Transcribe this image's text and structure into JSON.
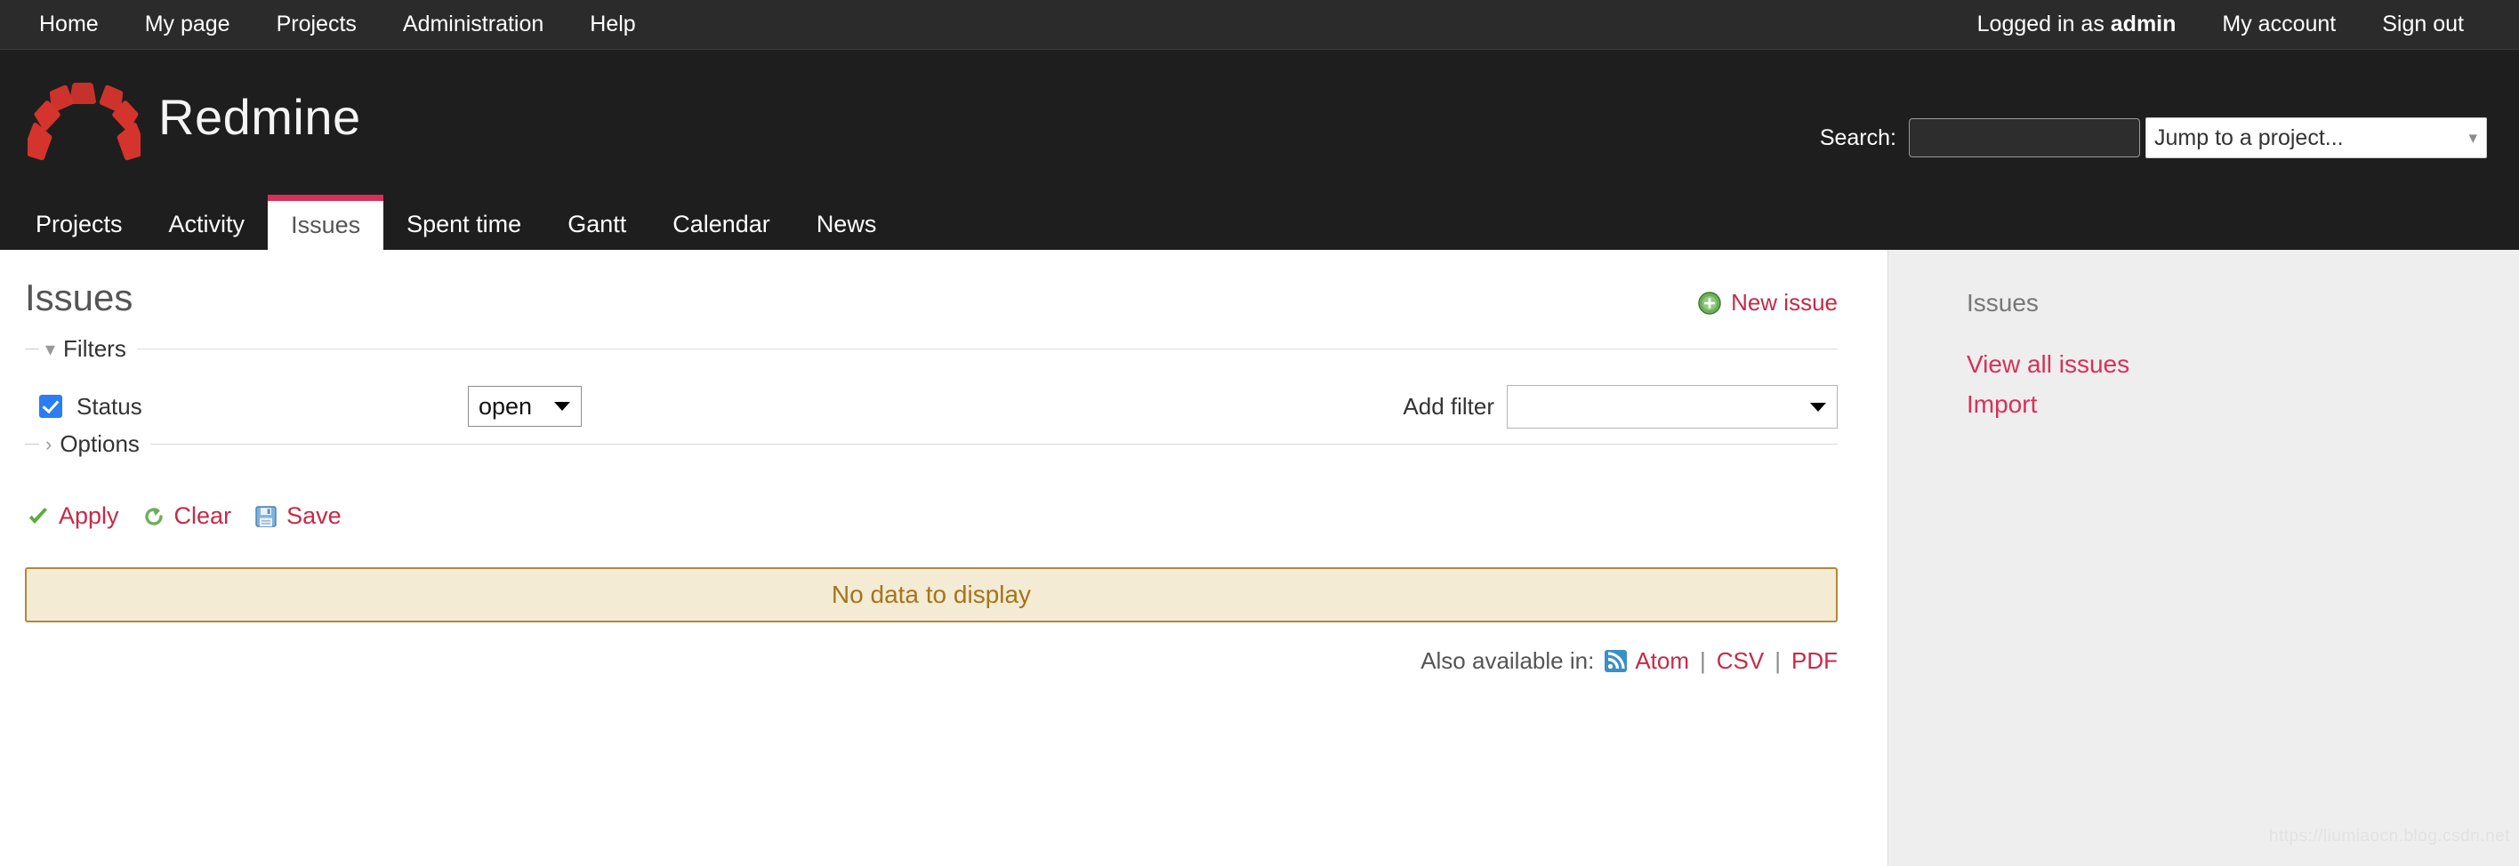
{
  "top_menu": {
    "left_links": [
      {
        "label": "Home",
        "name": "top-menu-home"
      },
      {
        "label": "My page",
        "name": "top-menu-my-page"
      },
      {
        "label": "Projects",
        "name": "top-menu-projects"
      },
      {
        "label": "Administration",
        "name": "top-menu-administration"
      },
      {
        "label": "Help",
        "name": "top-menu-help"
      }
    ],
    "logged_in_prefix": "Logged in as",
    "username": "admin",
    "my_account_label": "My account",
    "sign_out_label": "Sign out"
  },
  "header": {
    "app_title": "Redmine",
    "logo_icon": "redmine-arc-logo",
    "search_label": "Search:",
    "search_value": "",
    "search_placeholder": "",
    "project_jump_label": "Jump to a project...",
    "project_jump_icon": "chevron-down-icon"
  },
  "main_menu": {
    "tabs": [
      {
        "label": "Projects",
        "name": "tab-projects",
        "selected": false
      },
      {
        "label": "Activity",
        "name": "tab-activity",
        "selected": false
      },
      {
        "label": "Issues",
        "name": "tab-issues",
        "selected": true
      },
      {
        "label": "Spent time",
        "name": "tab-spent-time",
        "selected": false
      },
      {
        "label": "Gantt",
        "name": "tab-gantt",
        "selected": false
      },
      {
        "label": "Calendar",
        "name": "tab-calendar",
        "selected": false
      },
      {
        "label": "News",
        "name": "tab-news",
        "selected": false
      }
    ]
  },
  "content": {
    "page_title": "Issues",
    "new_issue_label": "New issue",
    "new_issue_icon": "add-circle-icon",
    "filters": {
      "legend": "Filters",
      "toggle_icon": "chevron-down-icon",
      "expanded": true,
      "rows": [
        {
          "checkbox_checked": true,
          "label": "Status",
          "operator_value": "open",
          "operator_icon": "caret-down-icon"
        }
      ],
      "add_filter_label": "Add filter",
      "add_filter_value": "",
      "add_filter_icon": "caret-down-icon"
    },
    "options": {
      "legend": "Options",
      "toggle_icon": "chevron-right-icon",
      "expanded": false
    },
    "actions": [
      {
        "label": "Apply",
        "name": "apply-button",
        "icon": "check-icon"
      },
      {
        "label": "Clear",
        "name": "clear-button",
        "icon": "reload-icon"
      },
      {
        "label": "Save",
        "name": "save-button",
        "icon": "floppy-disk-icon"
      }
    ],
    "nodata_message": "No data to display",
    "other_formats": {
      "label": "Also available in:",
      "feed_icon": "rss-feed-icon",
      "links": [
        {
          "label": "Atom",
          "name": "format-atom-link"
        },
        {
          "label": "CSV",
          "name": "format-csv-link"
        },
        {
          "label": "PDF",
          "name": "format-pdf-link"
        }
      ],
      "separator": "|"
    }
  },
  "sidebar": {
    "heading": "Issues",
    "links": [
      {
        "label": "View all issues",
        "name": "sidebar-view-all-issues"
      },
      {
        "label": "Import",
        "name": "sidebar-import"
      }
    ]
  },
  "watermark": "https://liumiaocn.blog.csdn.net",
  "colors": {
    "accent_red": "#c62a47",
    "tab_active_border": "#d6315a",
    "header_bg": "#1e1e1e",
    "topbar_bg": "#2b2b2b",
    "sidebar_bg": "#eeeeee",
    "nodata_bg": "#f3ebd4",
    "nodata_border": "#b2883a",
    "nodata_text": "#a5741c",
    "checkbox_blue": "#2a7df4",
    "logo_red": "#d4342c"
  }
}
